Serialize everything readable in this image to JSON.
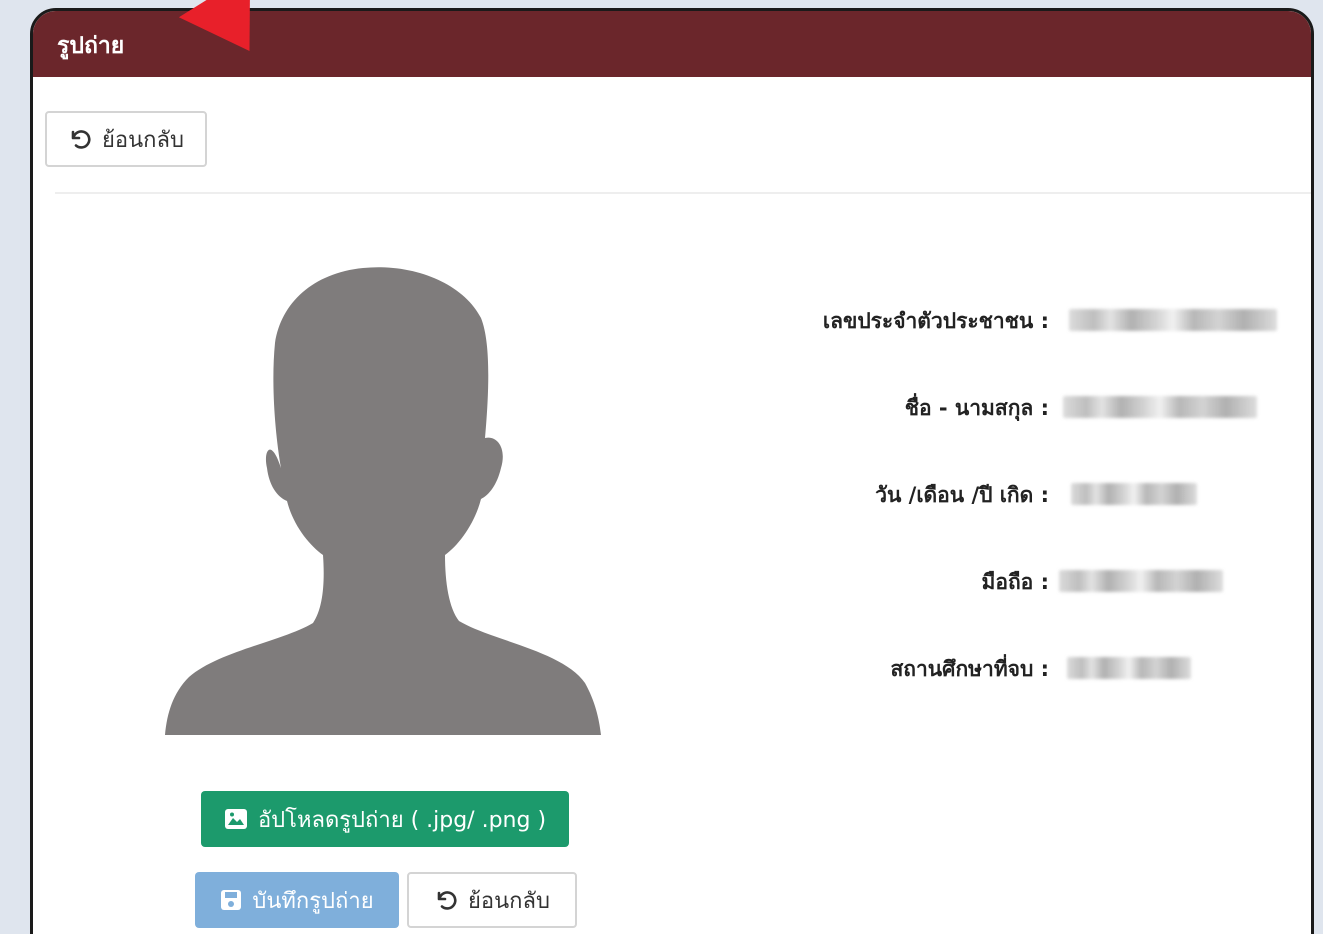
{
  "header": {
    "title": "รูปถ่าย"
  },
  "toolbar": {
    "back_label": "ย้อนกลับ"
  },
  "actions": {
    "upload_label": "อัปโหลดรูปถ่าย ( .jpg/ .png )",
    "save_label": "บันทึกรูปถ่าย",
    "back_label": "ย้อนกลับ"
  },
  "info": {
    "citizen_id_label": "เลขประจำตัวประชาชน :",
    "name_label": "ชื่อ - นามสกุล :",
    "birthdate_label": "วัน /เดือน /ปี เกิด :",
    "mobile_label": "มือถือ :",
    "school_label": "สถานศึกษาที่จบ :"
  },
  "colors": {
    "header": "#6b262b",
    "upload": "#1c9a6c",
    "save": "#7fafdb",
    "avatar": "#7f7c7c",
    "annotation_arrow": "#e8202a"
  },
  "icons": {
    "back": "undo-icon",
    "upload": "image-icon",
    "save": "floppy-disk-icon"
  }
}
